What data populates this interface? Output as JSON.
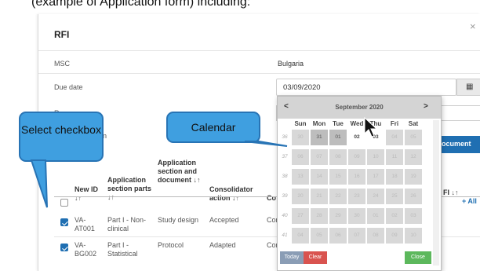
{
  "top_strip": {
    "text": "(example of Application form) including:"
  },
  "modal": {
    "title": "RFI",
    "close_symbol": "×",
    "fields": {
      "msc": {
        "label": "MSC",
        "value": "Bulgaria"
      },
      "due_date": {
        "label": "Due date",
        "value": "03/09/2020",
        "icon": "calendar-icon"
      },
      "reason": {
        "label": "Reason"
      },
      "documentation": {
        "label": "tation"
      }
    },
    "document_button": "ocument",
    "table": {
      "headers": {
        "new_id": "New ID",
        "application_section_parts": "Application section parts",
        "application_section_document": "Application section and document",
        "consolidator_action": "Consolidator action",
        "co": "Co",
        "rfi": "FI",
        "add_all": "+ All"
      },
      "sort_glyph": "↓↑",
      "rows": [
        {
          "checked": true,
          "new_id": "VA-AT001",
          "part": "Part I - Non-clinical",
          "document": "Study design",
          "action": "Accepted",
          "co": "Con"
        },
        {
          "checked": true,
          "new_id": "VA-BG002",
          "part": "Part I - Statistical",
          "document": "Protocol",
          "action": "Adapted",
          "co": "Con"
        }
      ]
    }
  },
  "calendar": {
    "title": "September 2020",
    "prev_label": "<",
    "next_label": ">",
    "day_headers": [
      "Sun",
      "Mon",
      "Tue",
      "Wed",
      "Thu",
      "Fri",
      "Sat"
    ],
    "weeks": [
      {
        "num": "36",
        "days": [
          "30",
          "31",
          "01",
          "02",
          "03",
          "04",
          "05"
        ]
      },
      {
        "num": "37",
        "days": [
          "06",
          "07",
          "08",
          "09",
          "10",
          "11",
          "12"
        ]
      },
      {
        "num": "38",
        "days": [
          "13",
          "14",
          "15",
          "16",
          "17",
          "18",
          "19"
        ]
      },
      {
        "num": "39",
        "days": [
          "20",
          "21",
          "22",
          "23",
          "24",
          "25",
          "26"
        ]
      },
      {
        "num": "40",
        "days": [
          "27",
          "28",
          "29",
          "30",
          "01",
          "02",
          "03"
        ]
      },
      {
        "num": "41",
        "days": [
          "04",
          "05",
          "06",
          "07",
          "08",
          "09",
          "10"
        ]
      }
    ],
    "selected_day": "03",
    "today_label": "Today",
    "clear_label": "Clear",
    "close_label": "Close"
  },
  "callouts": {
    "select_checkbox": "Select checkbox",
    "calendar": "Calendar"
  },
  "colors": {
    "accent_blue": "#1f6fb2",
    "callout_fill": "#3f9fe0",
    "callout_border": "#2874b5",
    "clear_red": "#d9534f",
    "close_green": "#5cb85c"
  }
}
